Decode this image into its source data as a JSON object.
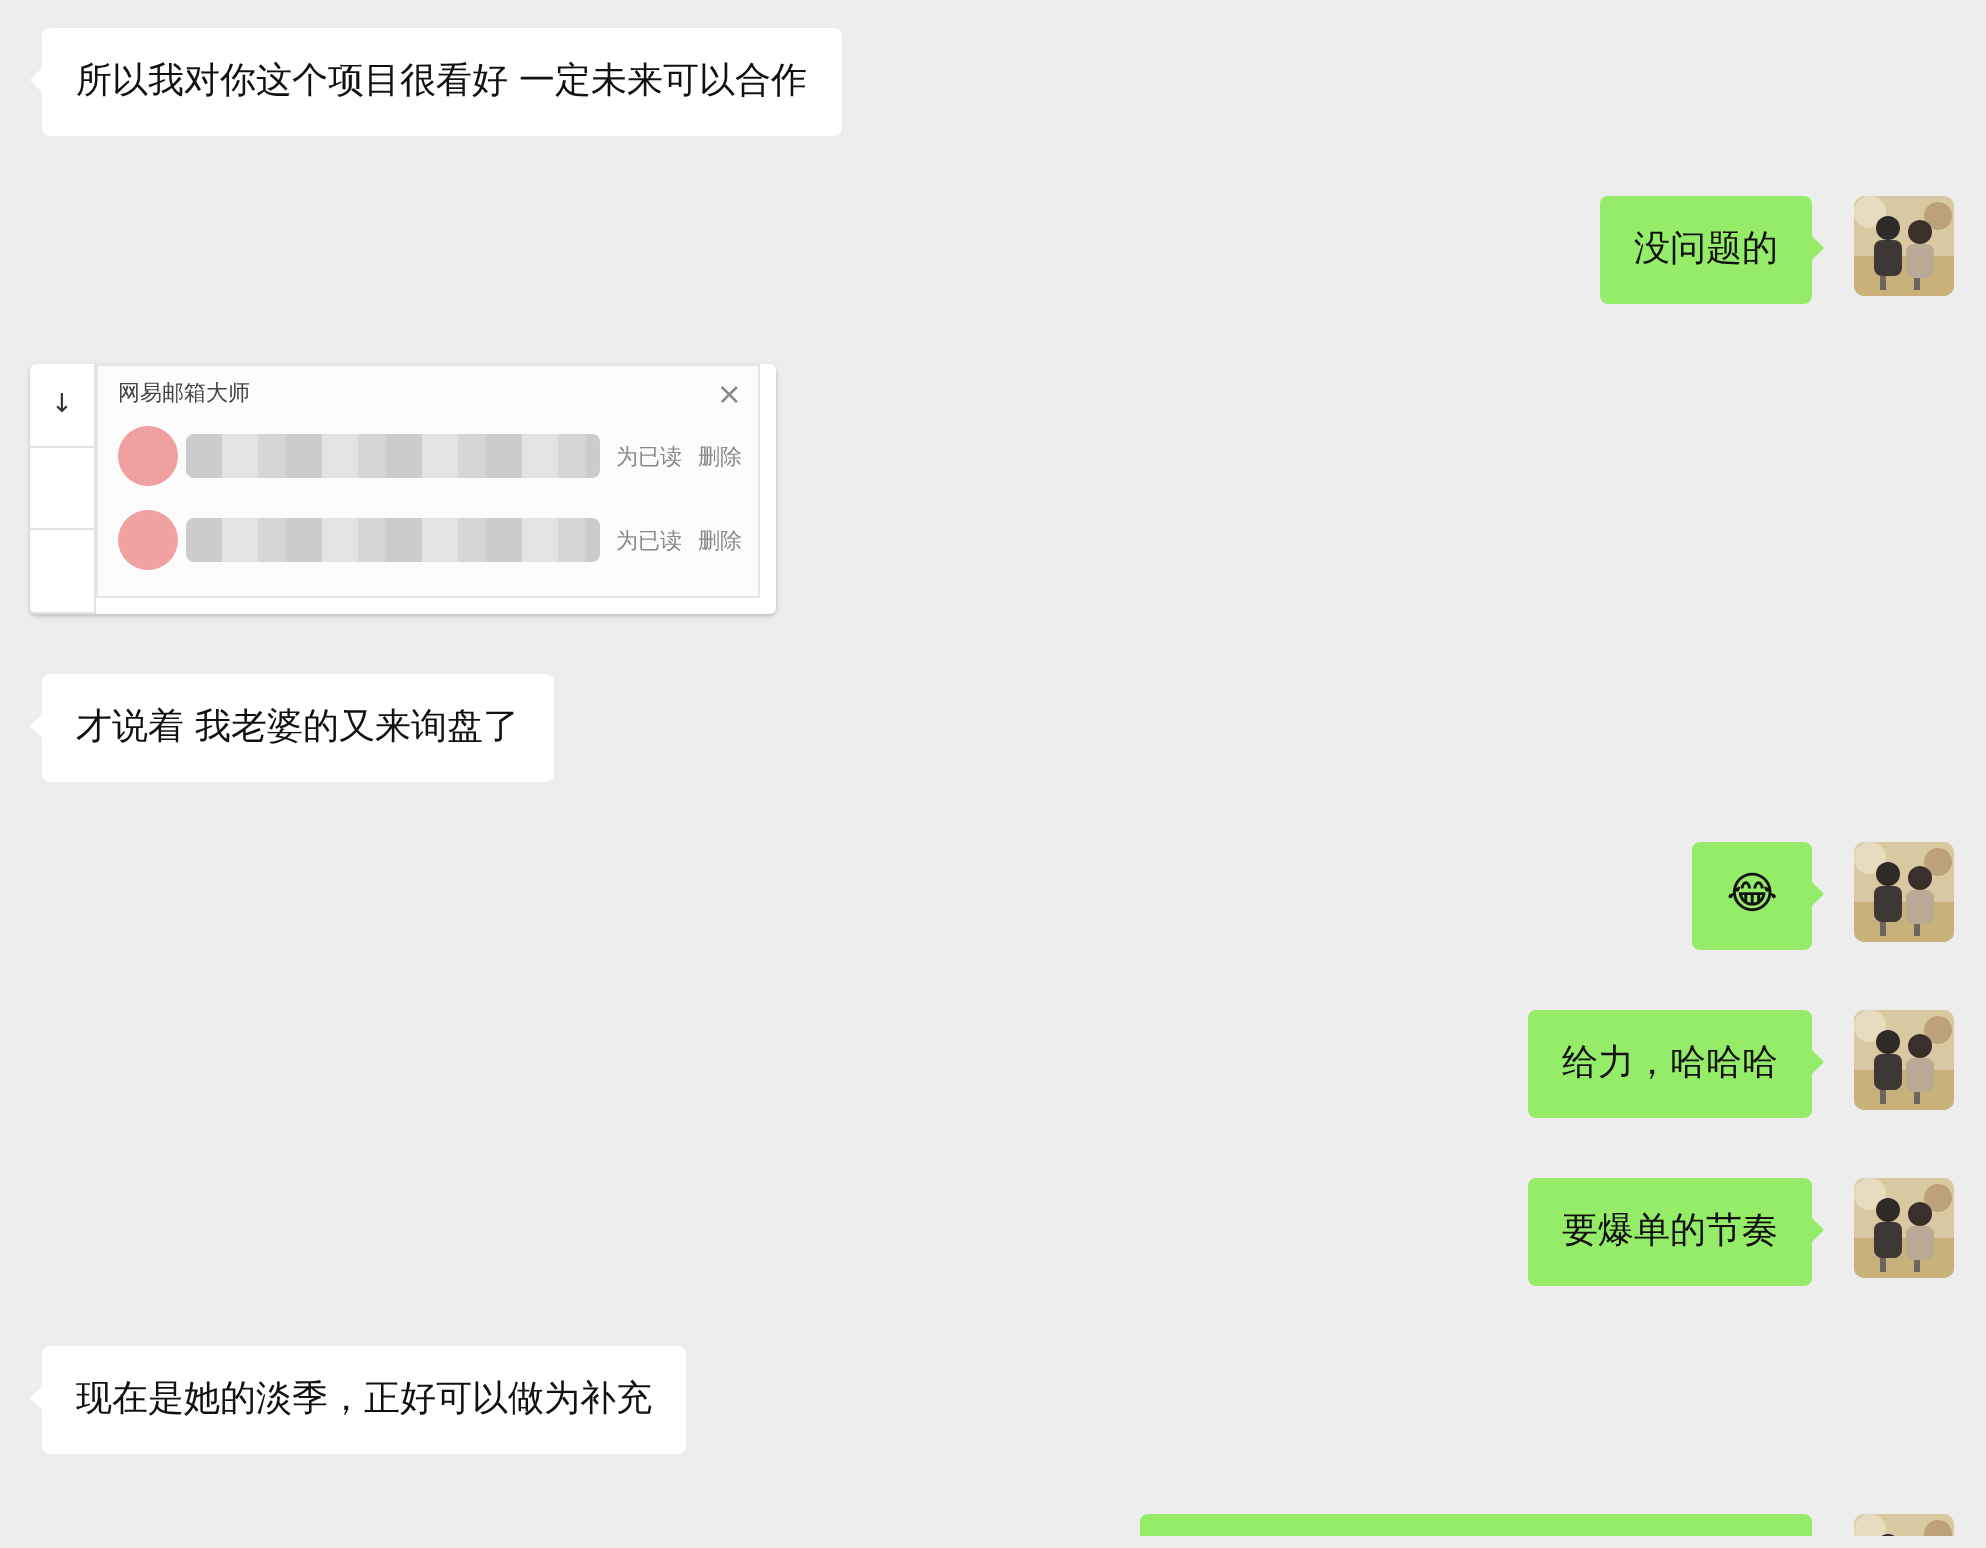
{
  "messages": [
    {
      "sent": false,
      "kind": "text",
      "text": "所以我对你这个项目很看好 一定未来可以合作"
    },
    {
      "sent": true,
      "kind": "text",
      "text": "没问题的"
    },
    {
      "sent": false,
      "kind": "screenshot",
      "screenshot": {
        "title": "网易邮箱大师",
        "close": "×",
        "arrow": "↓",
        "rows": [
          {
            "mark_read": "为已读",
            "delete": "删除"
          },
          {
            "mark_read": "为已读",
            "delete": "删除"
          }
        ]
      }
    },
    {
      "sent": false,
      "kind": "text",
      "text": "才说着 我老婆的又来询盘了"
    },
    {
      "sent": true,
      "kind": "text",
      "text": "😂"
    },
    {
      "sent": true,
      "kind": "text",
      "text": "给力，哈哈哈"
    },
    {
      "sent": true,
      "kind": "text",
      "text": "要爆单的节奏"
    },
    {
      "sent": false,
      "kind": "text",
      "text": "现在是她的淡季，正好可以做为补充"
    },
    {
      "sent": true,
      "kind": "cut"
    }
  ]
}
